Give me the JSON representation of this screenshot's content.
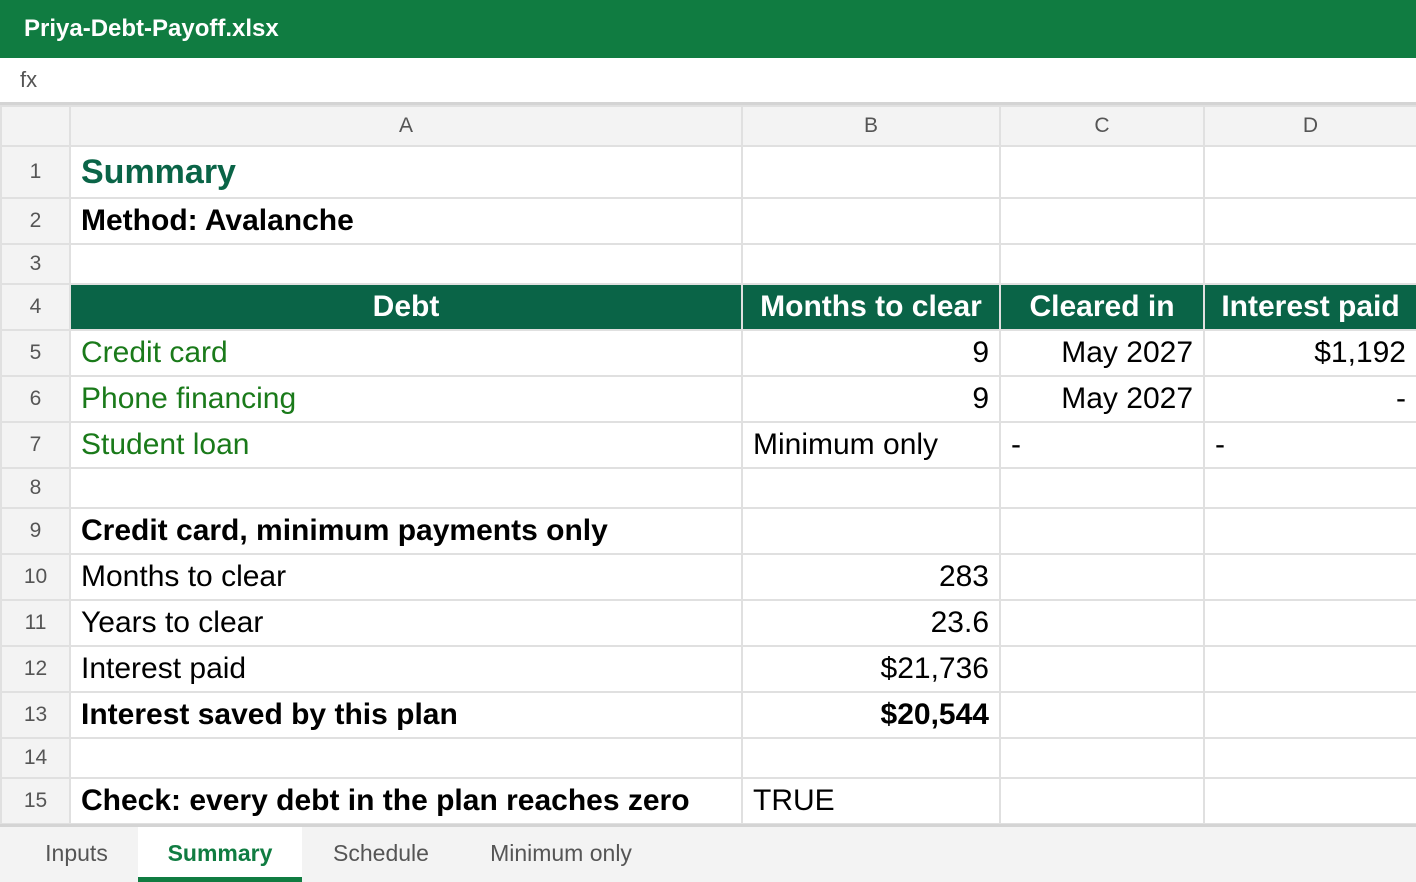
{
  "window": {
    "title": "Priya-Debt-Payoff.xlsx"
  },
  "formula_bar": {
    "label": "fx"
  },
  "columns": [
    "A",
    "B",
    "C",
    "D"
  ],
  "rows": [
    {
      "num": "1",
      "cells": [
        "Summary",
        "",
        "",
        ""
      ]
    },
    {
      "num": "2",
      "cells": [
        "Method: Avalanche",
        "",
        "",
        ""
      ]
    },
    {
      "num": "3",
      "cells": [
        "",
        "",
        "",
        ""
      ]
    },
    {
      "num": "4",
      "cells": [
        "Debt",
        "Months to clear",
        "Cleared in",
        "Interest paid"
      ]
    },
    {
      "num": "5",
      "cells": [
        "Credit card",
        "9",
        "May 2027",
        "$1,192"
      ]
    },
    {
      "num": "6",
      "cells": [
        "Phone financing",
        "9",
        "May 2027",
        "-"
      ]
    },
    {
      "num": "7",
      "cells": [
        "Student loan",
        "Minimum only",
        "-",
        "-"
      ]
    },
    {
      "num": "8",
      "cells": [
        "",
        "",
        "",
        ""
      ]
    },
    {
      "num": "9",
      "cells": [
        "Credit card, minimum payments only",
        "",
        "",
        ""
      ]
    },
    {
      "num": "10",
      "cells": [
        "Months to clear",
        "283",
        "",
        ""
      ]
    },
    {
      "num": "11",
      "cells": [
        "Years to clear",
        "23.6",
        "",
        ""
      ]
    },
    {
      "num": "12",
      "cells": [
        "Interest paid",
        "$21,736",
        "",
        ""
      ]
    },
    {
      "num": "13",
      "cells": [
        "Interest saved by this plan",
        "$20,544",
        "",
        ""
      ]
    },
    {
      "num": "14",
      "cells": [
        "",
        "",
        "",
        ""
      ]
    },
    {
      "num": "15",
      "cells": [
        "Check: every debt in the plan reaches zero",
        "TRUE",
        "",
        ""
      ]
    }
  ],
  "sheet_tabs": [
    {
      "label": "Inputs",
      "active": false
    },
    {
      "label": "Summary",
      "active": true
    },
    {
      "label": "Schedule",
      "active": false
    },
    {
      "label": "Minimum only",
      "active": false
    }
  ],
  "colors": {
    "title_bar": "#107c41",
    "header_fill": "#0a6447",
    "debt_name_text": "#1a7a1a",
    "active_tab": "#107c41"
  }
}
